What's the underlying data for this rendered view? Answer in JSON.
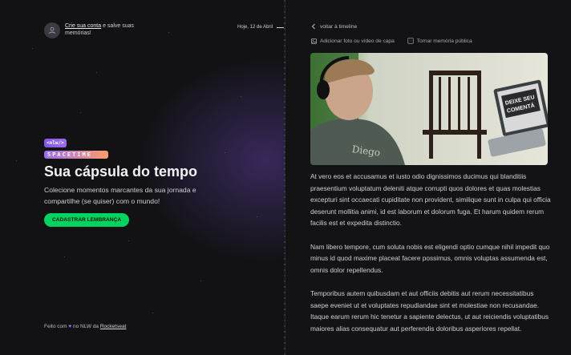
{
  "signin": {
    "link_text": "Crie sua conta",
    "rest_text": " e salve suas memórias!"
  },
  "timeline": {
    "date": "Hoje, 12 de Abril"
  },
  "hero": {
    "logo_tag": "<nlw/>",
    "logo_word": "SPACETIME",
    "title": "Sua cápsula do tempo",
    "subtitle": "Colecione momentos marcantes da sua jornada e compartilhe (se quiser) com o mundo!",
    "cta_label": "CADASTRAR LEMBRANÇA"
  },
  "footer": {
    "prefix": "Feito com ",
    "middle": " no NLW da ",
    "brand": "Rocketseat"
  },
  "memory": {
    "back_label": "voltar à timeline",
    "add_cover_label": "Adicionar foto ou vídeo de capa",
    "make_public_label": "Tornar memória pública",
    "paragraphs": [
      "At vero eos et accusamus et iusto odio dignissimos ducimus qui blanditiis praesentium voluptatum deleniti atque corrupti quos dolores et quas molestias excepturi sint occaecati cupiditate non provident, similique sunt in culpa qui officia deserunt mollitia animi, id est laborum et dolorum fuga. Et harum quidem rerum facilis est et expedita distinctio.",
      "Nam libero tempore, cum soluta nobis est eligendi optio cumque nihil impedit quo minus id quod maxime placeat facere possimus, omnis voluptas assumenda est, omnis dolor repellendus.",
      "Temporibus autem quibusdam et aut officiis debitis aut rerum necessitatibus saepe eveniet ut et voluptates repudiandae sint et molestiae non recusandae. Itaque earum rerum hic tenetur a sapiente delectus, ut aut reiciendis voluptatibus maiores alias consequatur aut perferendis doloribus asperiores repellat."
    ],
    "cover_laptop_text": "DEIXE SEU COMENTÁRIO"
  },
  "colors": {
    "accent_green": "#04d361",
    "accent_purple": "#8257e5",
    "background": "#121215"
  },
  "icons": [
    "user-icon",
    "chevron-left-icon",
    "image-icon",
    "heart-icon"
  ]
}
